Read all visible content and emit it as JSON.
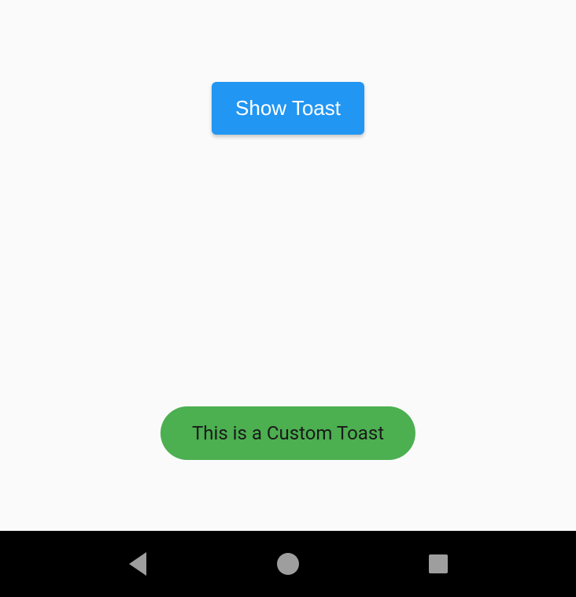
{
  "button": {
    "label": "Show Toast"
  },
  "toast": {
    "message": "This is a Custom Toast"
  }
}
